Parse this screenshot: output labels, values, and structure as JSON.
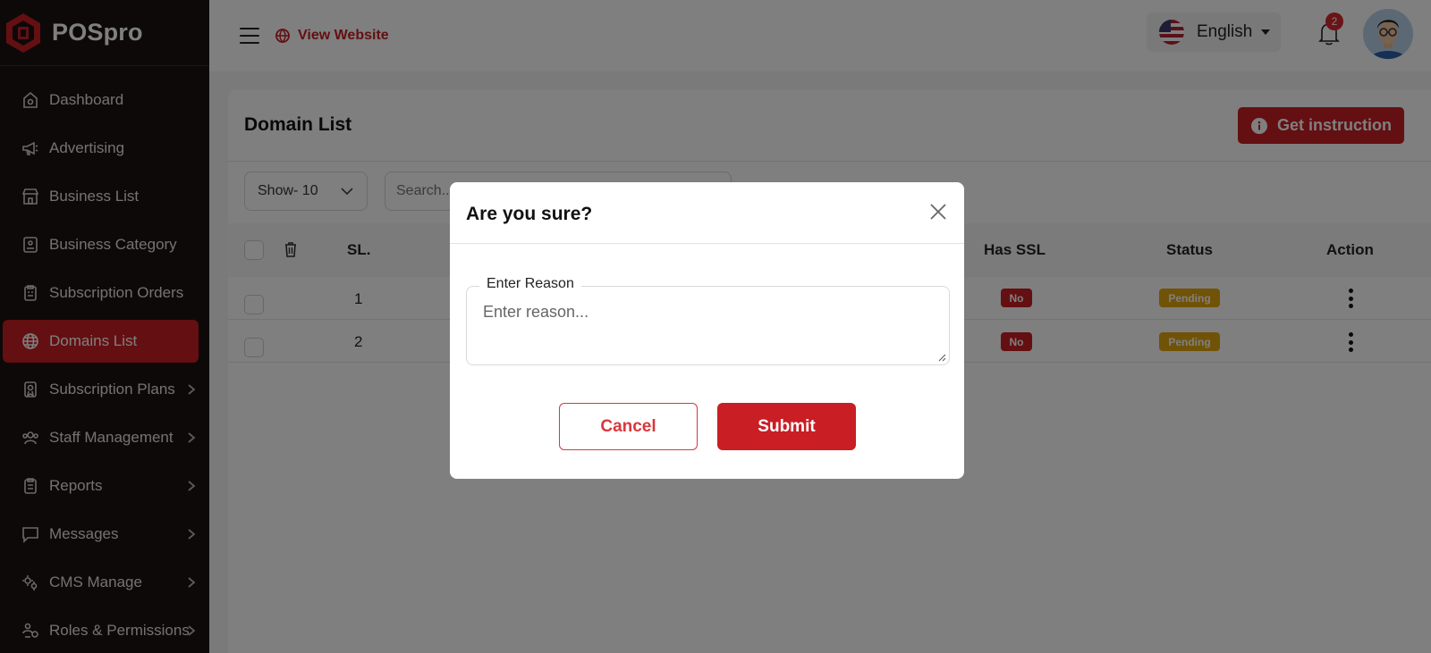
{
  "brand": {
    "name": "POSpro",
    "accent": "#c81e24"
  },
  "sidebar": {
    "items": [
      {
        "label": "Dashboard",
        "icon": "dashboard-icon",
        "active": false,
        "has_children": false
      },
      {
        "label": "Advertising",
        "icon": "megaphone-icon",
        "active": false,
        "has_children": false
      },
      {
        "label": "Business List",
        "icon": "store-icon",
        "active": false,
        "has_children": false
      },
      {
        "label": "Business Category",
        "icon": "category-icon",
        "active": false,
        "has_children": false
      },
      {
        "label": "Subscription Orders",
        "icon": "orders-icon",
        "active": false,
        "has_children": false
      },
      {
        "label": "Domains List",
        "icon": "globe-icon",
        "active": true,
        "has_children": false
      },
      {
        "label": "Subscription Plans",
        "icon": "plans-icon",
        "active": false,
        "has_children": true
      },
      {
        "label": "Staff Management",
        "icon": "staff-icon",
        "active": false,
        "has_children": true
      },
      {
        "label": "Reports",
        "icon": "reports-icon",
        "active": false,
        "has_children": true
      },
      {
        "label": "Messages",
        "icon": "message-icon",
        "active": false,
        "has_children": true
      },
      {
        "label": "CMS Manage",
        "icon": "gears-icon",
        "active": false,
        "has_children": true
      },
      {
        "label": "Roles & Permissions",
        "icon": "roles-icon",
        "active": false,
        "has_children": true
      }
    ]
  },
  "header": {
    "view_website": "View Website",
    "language": "English",
    "notification_count": "2"
  },
  "page": {
    "title": "Domain List",
    "instruction_button": "Get instruction",
    "show_select": "Show- 10",
    "search_placeholder": "Search..."
  },
  "table": {
    "headers": {
      "sl": "SL.",
      "has_ssl": "Has SSL",
      "status": "Status",
      "action": "Action"
    },
    "rows": [
      {
        "sl": "1",
        "has_ssl": "No",
        "status": "Pending"
      },
      {
        "sl": "2",
        "has_ssl": "No",
        "status": "Pending"
      }
    ]
  },
  "modal": {
    "title": "Are you sure?",
    "field_label": "Enter Reason",
    "field_placeholder": "Enter reason...",
    "cancel_label": "Cancel",
    "submit_label": "Submit"
  }
}
